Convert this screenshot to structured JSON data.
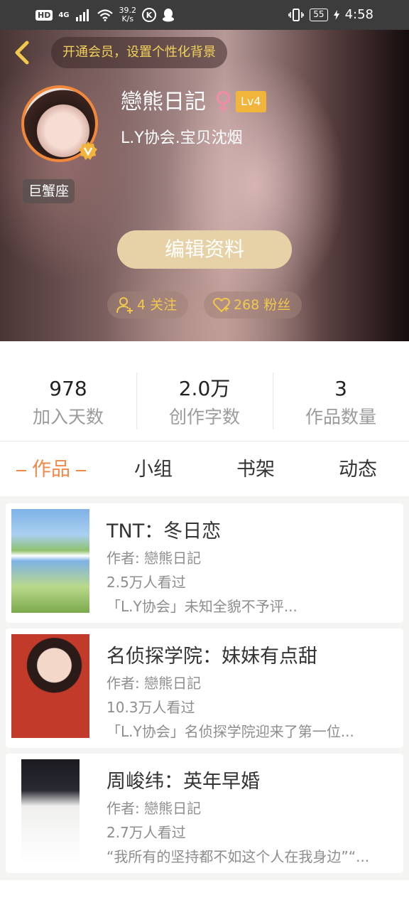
{
  "status_bar": {
    "hd": "HD",
    "network": "4G",
    "speed_value": "39.2",
    "speed_unit": "K/s",
    "vpn_letter": "K",
    "battery": "55",
    "time": "4:58"
  },
  "header": {
    "vip_prompt": "开通会员，设置个性化背景",
    "nickname": "戀熊日記",
    "gender_symbol": "♀",
    "level": "Lv4",
    "signature": "L.Y协会.宝贝沈烟",
    "zodiac": "巨蟹座",
    "edit_button": "编辑资料",
    "following": "4 关注",
    "fans": "268 粉丝",
    "colors": {
      "accent": "#f0884a",
      "gold": "#f2c94c",
      "level_badge": "#f0b53a"
    }
  },
  "stats": [
    {
      "value": "978",
      "label": "加入天数"
    },
    {
      "value": "2.0万",
      "label": "创作字数"
    },
    {
      "value": "3",
      "label": "作品数量"
    }
  ],
  "tabs": [
    {
      "label": "作品",
      "active": true
    },
    {
      "label": "小组",
      "active": false
    },
    {
      "label": "书架",
      "active": false
    },
    {
      "label": "动态",
      "active": false
    }
  ],
  "works": [
    {
      "title": "TNT：冬日恋",
      "author": "作者: 戀熊日記",
      "views": "2.5万人看过",
      "desc": "「L.Y协会」未知全貌不予评..."
    },
    {
      "title": "名侦探学院：妹妹有点甜",
      "author": "作者: 戀熊日記",
      "views": "10.3万人看过",
      "desc": "「L.Y协会」名侦探学院迎来了第一位..."
    },
    {
      "title": "周峻纬：英年早婚",
      "author": "作者: 戀熊日記",
      "views": "2.7万人看过",
      "desc": "“我所有的坚持都不如这个人在我身边”“..."
    }
  ]
}
